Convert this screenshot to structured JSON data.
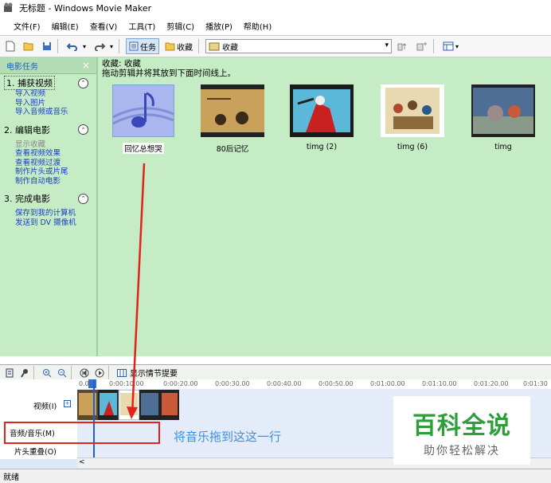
{
  "window": {
    "title": "无标题 - Windows Movie Maker"
  },
  "menu": [
    "文件(F)",
    "编辑(E)",
    "查看(V)",
    "工具(T)",
    "剪辑(C)",
    "播放(P)",
    "帮助(H)"
  ],
  "toolbar": {
    "tasks_label": "任务",
    "collections_label": "收藏",
    "combo_value": "收藏"
  },
  "left_panel": {
    "title": "电影任务",
    "close": "×",
    "sections": [
      {
        "title": "1. 捕获视频",
        "links": [
          "导入视频",
          "导入图片",
          "导入音频或音乐"
        ]
      },
      {
        "title": "2. 编辑电影",
        "links": [
          "显示收藏",
          "查看视频效果",
          "查看视频过渡",
          "制作片头或片尾",
          "制作自动电影"
        ]
      },
      {
        "title": "3. 完成电影",
        "links": [
          "保存到我的计算机",
          "发送到 DV 摄像机"
        ]
      }
    ]
  },
  "main": {
    "heading": "收藏: 收藏",
    "subheading": "拖动剪辑并将其放到下面时间线上。",
    "clips": [
      {
        "label": "回忆总想哭",
        "kind": "music"
      },
      {
        "label": "80后记忆",
        "kind": "video"
      },
      {
        "label": "timg (2)",
        "kind": "video"
      },
      {
        "label": "timg (6)",
        "kind": "video"
      },
      {
        "label": "timg",
        "kind": "video"
      }
    ]
  },
  "storyboard_bar": {
    "label": "显示情节提要"
  },
  "timeline": {
    "ruler_labels": [
      "0.00",
      "0:00:10.00",
      "0:00:20.00",
      "0:00:30.00",
      "0:00:40.00",
      "0:00:50.00",
      "0:01:00.00",
      "0:01:10.00",
      "0:01:20.00",
      "0:01:30"
    ],
    "track_video": "视频(I)",
    "track_audio": "音频/音乐(M)",
    "track_title": "片头重叠(O)"
  },
  "status": "就绪",
  "annotation": "将音乐拖到这这一行",
  "watermark": {
    "big": "百科全说",
    "small": "助你轻松解决"
  },
  "colors": {
    "panel_green": "#c6ecc6",
    "annotation_red": "#e0241b",
    "annotation_blue": "#3d8fe0",
    "watermark_green": "#2e9e3a"
  }
}
